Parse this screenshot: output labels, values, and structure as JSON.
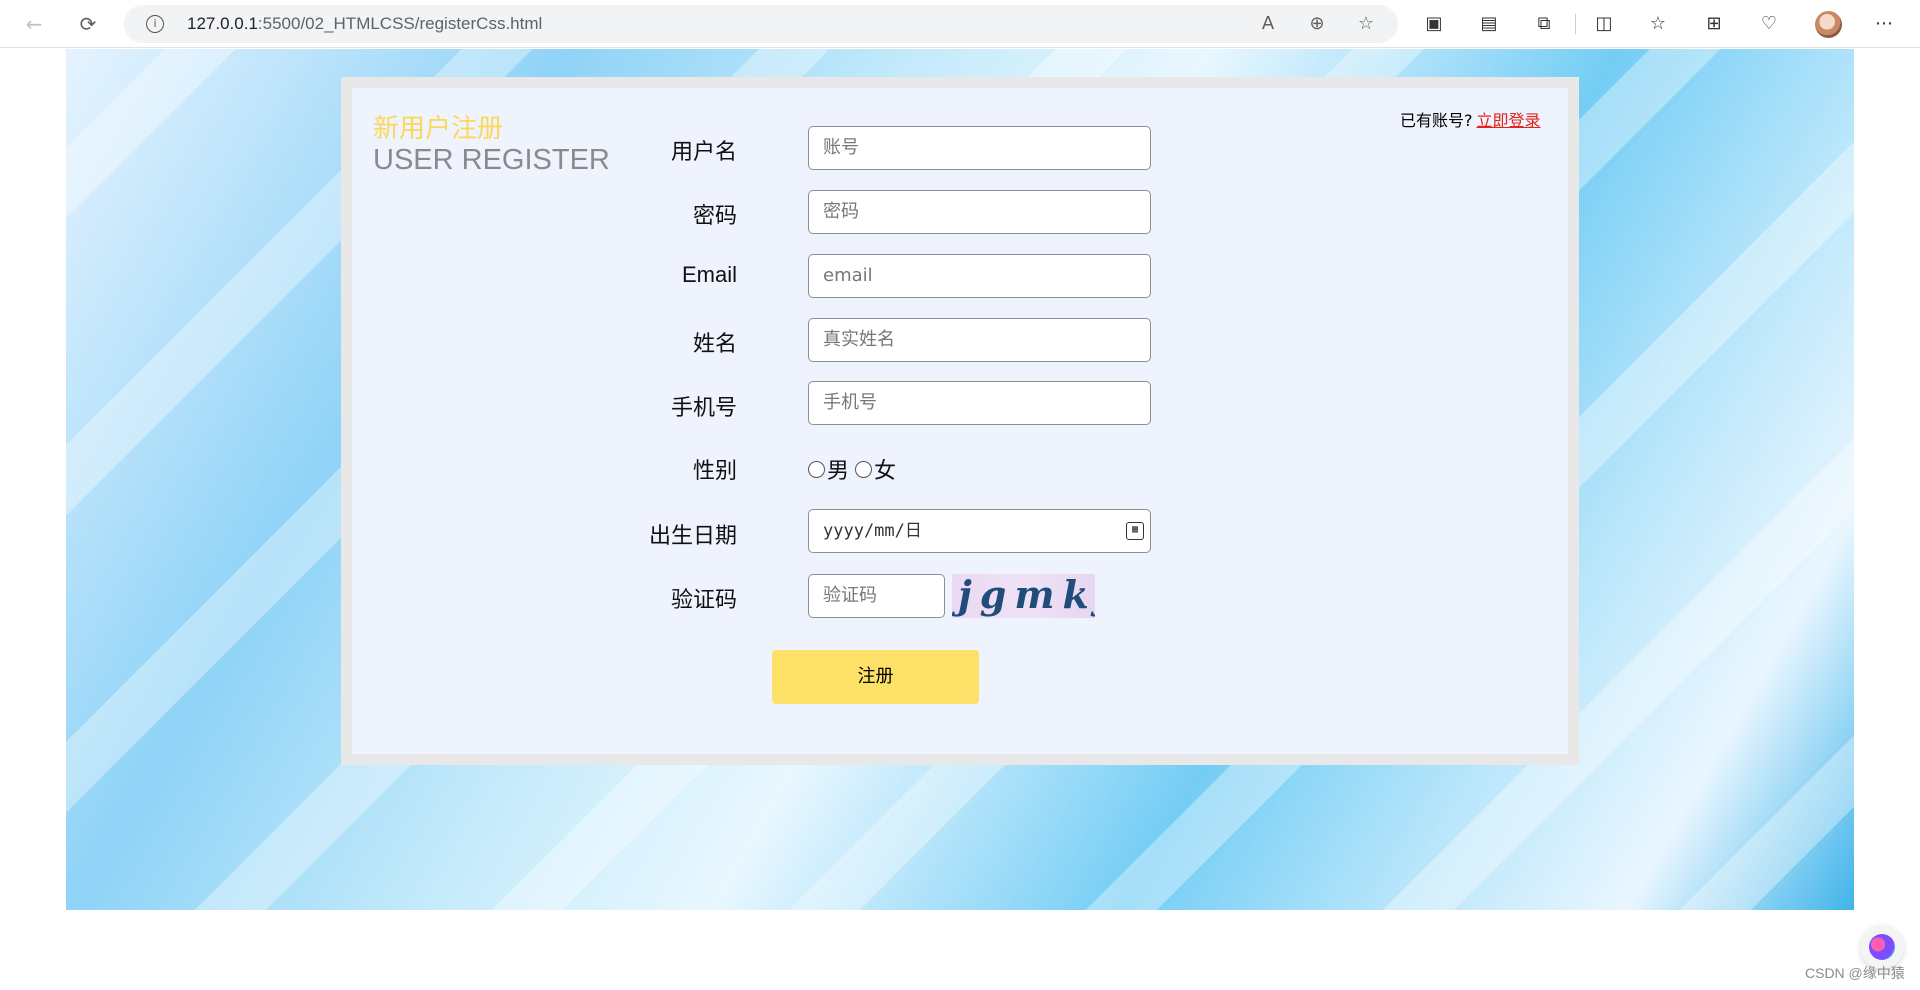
{
  "browser": {
    "url_host": "127.0.0.1",
    "url_rest": ":5500/02_HTMLCSS/registerCss.html",
    "icons": [
      "back-icon",
      "reload-icon",
      "site-info-icon",
      "read-aloud-icon",
      "zoom-icon",
      "favorite-icon",
      "extension-icon",
      "split-screen-icon",
      "favorites-icon",
      "collections-icon",
      "browser-essentials-icon",
      "more-icon"
    ]
  },
  "page": {
    "title_cn": "新用户注册",
    "title_en": "USER REGISTER",
    "login_prompt": "已有账号?",
    "login_link": "立即登录",
    "accent_color": "#fcd85a",
    "link_color": "#e1251b"
  },
  "form": {
    "username": {
      "label": "用户名",
      "placeholder": "账号"
    },
    "password": {
      "label": "密码",
      "placeholder": "密码"
    },
    "email": {
      "label": "Email",
      "placeholder": "email"
    },
    "name": {
      "label": "姓名",
      "placeholder": "真实姓名"
    },
    "phone": {
      "label": "手机号",
      "placeholder": "手机号"
    },
    "gender": {
      "label": "性别",
      "male": "男",
      "female": "女"
    },
    "birthday": {
      "label": "出生日期",
      "placeholder": "yyyy/mm/日"
    },
    "captcha": {
      "label": "验证码",
      "placeholder": "验证码",
      "image_text": "jgmkj"
    },
    "submit": "注册"
  },
  "footer": {
    "watermark": "CSDN @缘中猿"
  }
}
